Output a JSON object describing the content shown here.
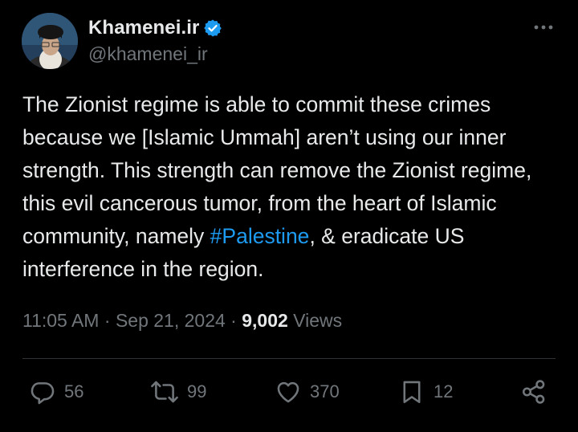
{
  "author": {
    "display_name": "Khamenei.ir",
    "handle": "@khamenei_ir",
    "verified": true,
    "verified_color": "#1d9bf0"
  },
  "tweet": {
    "text_before": "The Zionist regime is able to commit these crimes because we [Islamic Ummah] aren’t using our inner strength. This strength can remove the Zionist regime, this evil cancerous tumor, from the heart of Islamic community, namely ",
    "hashtag": "#Palestine",
    "text_after": ", & eradicate US interference in the region."
  },
  "meta": {
    "time": "11:05 AM",
    "separator": " · ",
    "date": "Sep 21, 2024",
    "views_count": "9,002",
    "views_label": " Views"
  },
  "actions": {
    "replies": "56",
    "reposts": "99",
    "likes": "370",
    "bookmarks": "12"
  },
  "colors": {
    "background": "#000000",
    "text": "#e7e9ea",
    "secondary": "#71767b",
    "accent": "#1d9bf0",
    "divider": "#2f3336"
  },
  "icons": [
    "verified-badge-icon",
    "more-options-icon",
    "reply-icon",
    "repost-icon",
    "like-icon",
    "bookmark-icon",
    "share-icon"
  ]
}
